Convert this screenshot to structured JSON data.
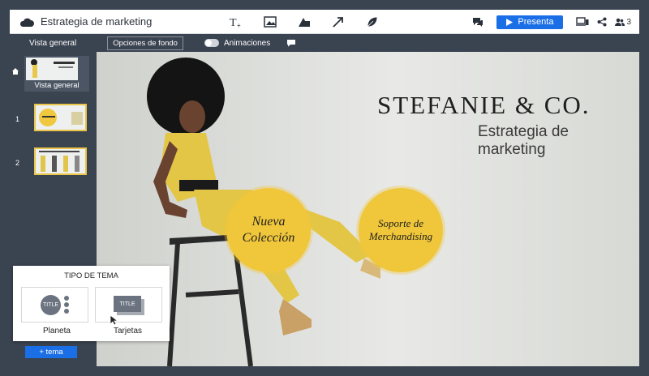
{
  "header": {
    "title": "Estrategia de marketing",
    "present_label": "Presenta",
    "users_count": "3",
    "tool_icons": [
      "text-icon",
      "image-icon",
      "shapes-icon",
      "arrow-icon",
      "leaf-icon"
    ]
  },
  "subbar": {
    "overview_label": "Vista general",
    "background_label": "Opciones de fondo",
    "animations_label": "Animaciones"
  },
  "sidebar": {
    "overview_label": "Vista general",
    "slides": [
      {
        "number": "1"
      },
      {
        "number": "2"
      }
    ]
  },
  "canvas": {
    "brand": "STEFANIE & CO.",
    "subtitle": "Estrategia de marketing",
    "circle1": "Nueva Colección",
    "circle2": "Soporte de Merchandising",
    "accent_color": "#f0c63b"
  },
  "theme_panel": {
    "title": "TIPO DE TEMA",
    "options": [
      {
        "label": "Planeta",
        "thumb_text": "TITLE"
      },
      {
        "label": "Tarjetas",
        "thumb_text": "TITLE"
      }
    ]
  },
  "theme_button": {
    "label": "+ tema"
  }
}
